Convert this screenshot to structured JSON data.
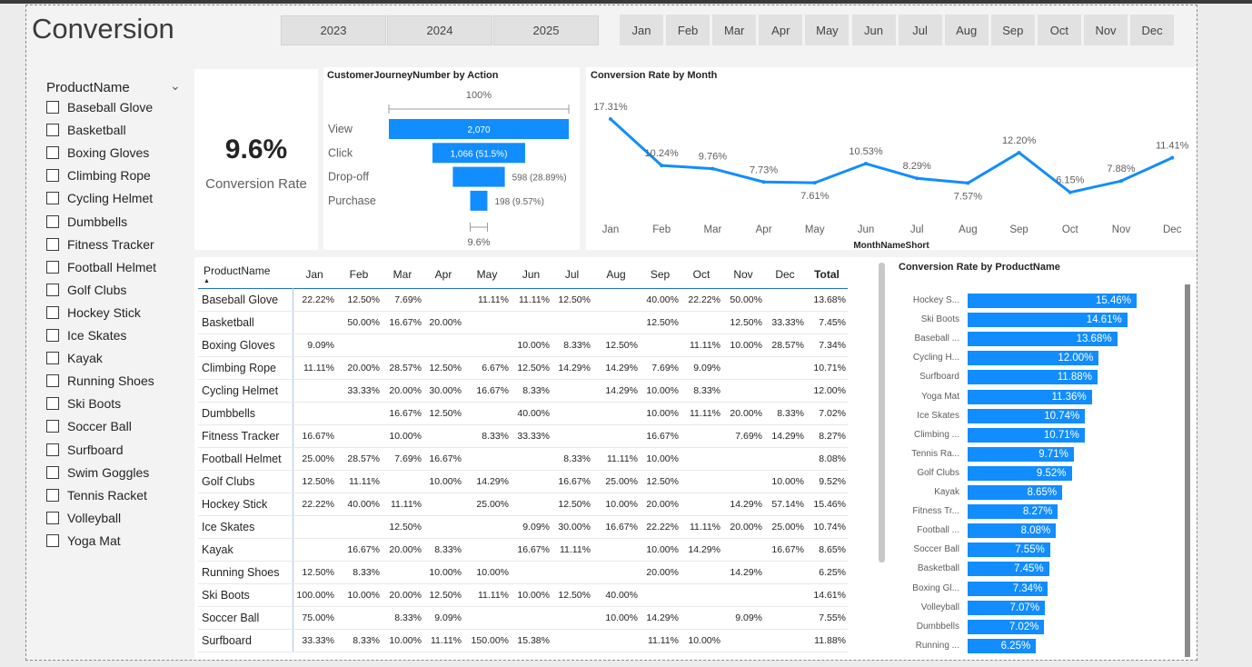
{
  "page_title": "Conversion",
  "years": [
    "2023",
    "2024",
    "2025"
  ],
  "months": [
    "Jan",
    "Feb",
    "Mar",
    "Apr",
    "May",
    "Jun",
    "Jul",
    "Aug",
    "Sep",
    "Oct",
    "Nov",
    "Dec"
  ],
  "slicer": {
    "header": "ProductName",
    "items": [
      "Baseball Glove",
      "Basketball",
      "Boxing Gloves",
      "Climbing Rope",
      "Cycling Helmet",
      "Dumbbells",
      "Fitness Tracker",
      "Football Helmet",
      "Golf Clubs",
      "Hockey Stick",
      "Ice Skates",
      "Kayak",
      "Running Shoes",
      "Ski Boots",
      "Soccer Ball",
      "Surfboard",
      "Swim Goggles",
      "Tennis Racket",
      "Volleyball",
      "Yoga Mat"
    ]
  },
  "kpi": {
    "value": "9.6%",
    "label": "Conversion Rate"
  },
  "funnel": {
    "title": "CustomerJourneyNumber by Action",
    "top_label": "100%",
    "bottom_label": "9.6%",
    "stages": [
      {
        "name": "View",
        "value": 2070,
        "label": "2,070"
      },
      {
        "name": "Click",
        "value": 1066,
        "label": "1,066 (51.5%)"
      },
      {
        "name": "Drop-off",
        "value": 598,
        "label": "598 (28.89%)"
      },
      {
        "name": "Purchase",
        "value": 198,
        "label": "198 (9.57%)"
      }
    ]
  },
  "line": {
    "title": "Conversion Rate by Month",
    "xlabel": "MonthNameShort"
  },
  "matrix": {
    "row_header": "ProductName",
    "columns": [
      "Jan",
      "Feb",
      "Mar",
      "Apr",
      "May",
      "Jun",
      "Jul",
      "Aug",
      "Sep",
      "Oct",
      "Nov",
      "Dec",
      "Total"
    ],
    "rows": [
      {
        "name": "Baseball Glove",
        "cells": [
          "22.22%",
          "12.50%",
          "7.69%",
          "",
          "11.11%",
          "11.11%",
          "12.50%",
          "",
          "40.00%",
          "22.22%",
          "50.00%",
          "",
          "13.68%"
        ]
      },
      {
        "name": "Basketball",
        "cells": [
          "",
          "50.00%",
          "16.67%",
          "20.00%",
          "",
          "",
          "",
          "",
          "12.50%",
          "",
          "12.50%",
          "33.33%",
          "7.45%"
        ]
      },
      {
        "name": "Boxing Gloves",
        "cells": [
          "9.09%",
          "",
          "",
          "",
          "",
          "10.00%",
          "8.33%",
          "12.50%",
          "",
          "11.11%",
          "10.00%",
          "28.57%",
          "7.34%"
        ]
      },
      {
        "name": "Climbing Rope",
        "cells": [
          "11.11%",
          "20.00%",
          "28.57%",
          "12.50%",
          "6.67%",
          "12.50%",
          "14.29%",
          "14.29%",
          "7.69%",
          "9.09%",
          "",
          "",
          "10.71%"
        ]
      },
      {
        "name": "Cycling Helmet",
        "cells": [
          "",
          "33.33%",
          "20.00%",
          "30.00%",
          "16.67%",
          "8.33%",
          "",
          "14.29%",
          "10.00%",
          "8.33%",
          "",
          "",
          "12.00%"
        ]
      },
      {
        "name": "Dumbbells",
        "cells": [
          "",
          "",
          "16.67%",
          "12.50%",
          "",
          "40.00%",
          "",
          "",
          "10.00%",
          "11.11%",
          "20.00%",
          "8.33%",
          "7.02%"
        ]
      },
      {
        "name": "Fitness Tracker",
        "cells": [
          "16.67%",
          "",
          "10.00%",
          "",
          "8.33%",
          "33.33%",
          "",
          "",
          "16.67%",
          "",
          "7.69%",
          "14.29%",
          "8.27%"
        ]
      },
      {
        "name": "Football Helmet",
        "cells": [
          "25.00%",
          "28.57%",
          "7.69%",
          "16.67%",
          "",
          "",
          "8.33%",
          "11.11%",
          "10.00%",
          "",
          "",
          "",
          "8.08%"
        ]
      },
      {
        "name": "Golf Clubs",
        "cells": [
          "12.50%",
          "11.11%",
          "",
          "10.00%",
          "14.29%",
          "",
          "16.67%",
          "25.00%",
          "12.50%",
          "",
          "",
          "10.00%",
          "9.52%"
        ]
      },
      {
        "name": "Hockey Stick",
        "cells": [
          "22.22%",
          "40.00%",
          "11.11%",
          "",
          "25.00%",
          "",
          "12.50%",
          "10.00%",
          "20.00%",
          "",
          "14.29%",
          "57.14%",
          "15.46%"
        ]
      },
      {
        "name": "Ice Skates",
        "cells": [
          "",
          "",
          "12.50%",
          "",
          "",
          "9.09%",
          "30.00%",
          "16.67%",
          "22.22%",
          "11.11%",
          "20.00%",
          "25.00%",
          "10.74%"
        ]
      },
      {
        "name": "Kayak",
        "cells": [
          "",
          "16.67%",
          "20.00%",
          "8.33%",
          "",
          "16.67%",
          "11.11%",
          "",
          "10.00%",
          "14.29%",
          "",
          "16.67%",
          "8.65%"
        ]
      },
      {
        "name": "Running Shoes",
        "cells": [
          "12.50%",
          "8.33%",
          "",
          "10.00%",
          "10.00%",
          "",
          "",
          "",
          "20.00%",
          "",
          "14.29%",
          "",
          "6.25%"
        ]
      },
      {
        "name": "Ski Boots",
        "cells": [
          "100.00%",
          "10.00%",
          "20.00%",
          "12.50%",
          "11.11%",
          "10.00%",
          "12.50%",
          "40.00%",
          "",
          "",
          "",
          "",
          "14.61%"
        ]
      },
      {
        "name": "Soccer Ball",
        "cells": [
          "75.00%",
          "",
          "8.33%",
          "9.09%",
          "",
          "",
          "",
          "10.00%",
          "14.29%",
          "",
          "9.09%",
          "",
          "7.55%"
        ]
      },
      {
        "name": "Surfboard",
        "cells": [
          "33.33%",
          "8.33%",
          "10.00%",
          "11.11%",
          "150.00%",
          "15.38%",
          "",
          "",
          "11.11%",
          "10.00%",
          "",
          "",
          "11.88%"
        ]
      }
    ]
  },
  "bar_title": "Conversion Rate by ProductName",
  "colors": {
    "accent": "#118dff",
    "bar": "#118dff",
    "canvas": "#f3f3f3"
  },
  "chart_data": [
    {
      "type": "line",
      "title": "Conversion Rate by Month",
      "xlabel": "MonthNameShort",
      "categories": [
        "Jan",
        "Feb",
        "Mar",
        "Apr",
        "May",
        "Jun",
        "Jul",
        "Aug",
        "Sep",
        "Oct",
        "Nov",
        "Dec"
      ],
      "values": [
        17.31,
        10.24,
        9.76,
        7.73,
        7.61,
        10.53,
        8.29,
        7.57,
        12.2,
        6.15,
        7.88,
        11.41
      ],
      "labels": [
        "17.31%",
        "10.24%",
        "9.76%",
        "7.73%",
        "7.61%",
        "10.53%",
        "8.29%",
        "7.57%",
        "12.20%",
        "6.15%",
        "7.88%",
        "11.41%"
      ],
      "ylim": [
        5,
        18
      ]
    },
    {
      "type": "bar",
      "title": "Conversion Rate by ProductName",
      "categories": [
        "Hockey S...",
        "Ski Boots",
        "Baseball ...",
        "Cycling H...",
        "Surfboard",
        "Yoga Mat",
        "Ice Skates",
        "Climbing ...",
        "Tennis Ra...",
        "Golf Clubs",
        "Kayak",
        "Fitness Tr...",
        "Football ...",
        "Soccer Ball",
        "Basketball",
        "Boxing Gl...",
        "Volleyball",
        "Dumbbells",
        "Running ..."
      ],
      "values": [
        15.46,
        14.61,
        13.68,
        12.0,
        11.88,
        11.36,
        10.74,
        10.71,
        9.71,
        9.52,
        8.65,
        8.27,
        8.08,
        7.55,
        7.45,
        7.34,
        7.07,
        7.02,
        6.25
      ],
      "labels": [
        "15.46%",
        "14.61%",
        "13.68%",
        "12.00%",
        "11.88%",
        "11.36%",
        "10.74%",
        "10.71%",
        "9.71%",
        "9.52%",
        "8.65%",
        "8.27%",
        "8.08%",
        "7.55%",
        "7.45%",
        "7.34%",
        "7.07%",
        "7.02%",
        "6.25%"
      ]
    }
  ]
}
